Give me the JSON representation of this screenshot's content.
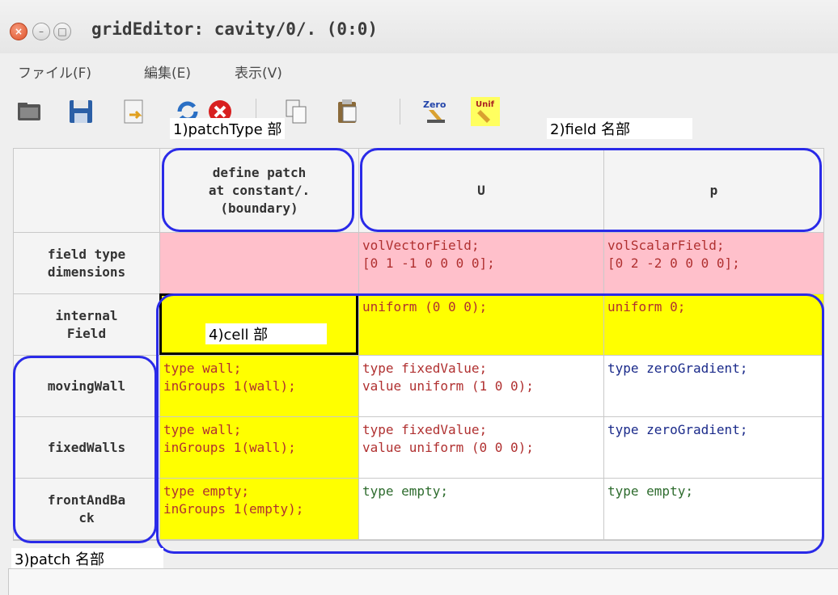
{
  "window": {
    "title": "gridEditor: cavity/0/. (0:0)"
  },
  "menu": [
    "ファイル(F)",
    "編集(E)",
    "表示(V)"
  ],
  "toolbar": [
    "open-icon",
    "save-icon",
    "export-icon",
    "reload-icon",
    "cancel-icon",
    "copy-icon",
    "paste-icon",
    "zero-icon",
    "uniform-icon"
  ],
  "annotations": {
    "patch_type": "1)patchType 部",
    "field_name": "2)field 名部",
    "patch_name": "3)patch 名部",
    "cell": "4)cell 部"
  },
  "grid": {
    "headers": {
      "define_patch": "define patch\nat constant/.\n(boundary)",
      "U": "U",
      "p": "p"
    },
    "rows": [
      {
        "label": "field type\ndimensions",
        "define": "",
        "U": "volVectorField;\n[0 1 -1 0 0 0 0];",
        "p": "volScalarField;\n[0 2 -2 0 0 0 0];"
      },
      {
        "label": "internal\nField",
        "define": "",
        "U": "uniform (0 0 0);",
        "p": "uniform 0;"
      },
      {
        "label": "movingWall",
        "define": "type wall;\ninGroups 1(wall);",
        "U": "type fixedValue;\nvalue uniform (1 0 0);",
        "p": "type zeroGradient;"
      },
      {
        "label": "fixedWalls",
        "define": "type wall;\ninGroups 1(wall);",
        "U": "type fixedValue;\nvalue uniform (0 0 0);",
        "p": "type zeroGradient;"
      },
      {
        "label": "frontAndBa\nck",
        "define": "type empty;\ninGroups 1(empty);",
        "U": "type empty;",
        "p": "type empty;"
      }
    ]
  },
  "colors": {
    "accent_blue": "#2a2ae8",
    "pink": "#ffc0cb",
    "yellow": "#ffff00"
  }
}
